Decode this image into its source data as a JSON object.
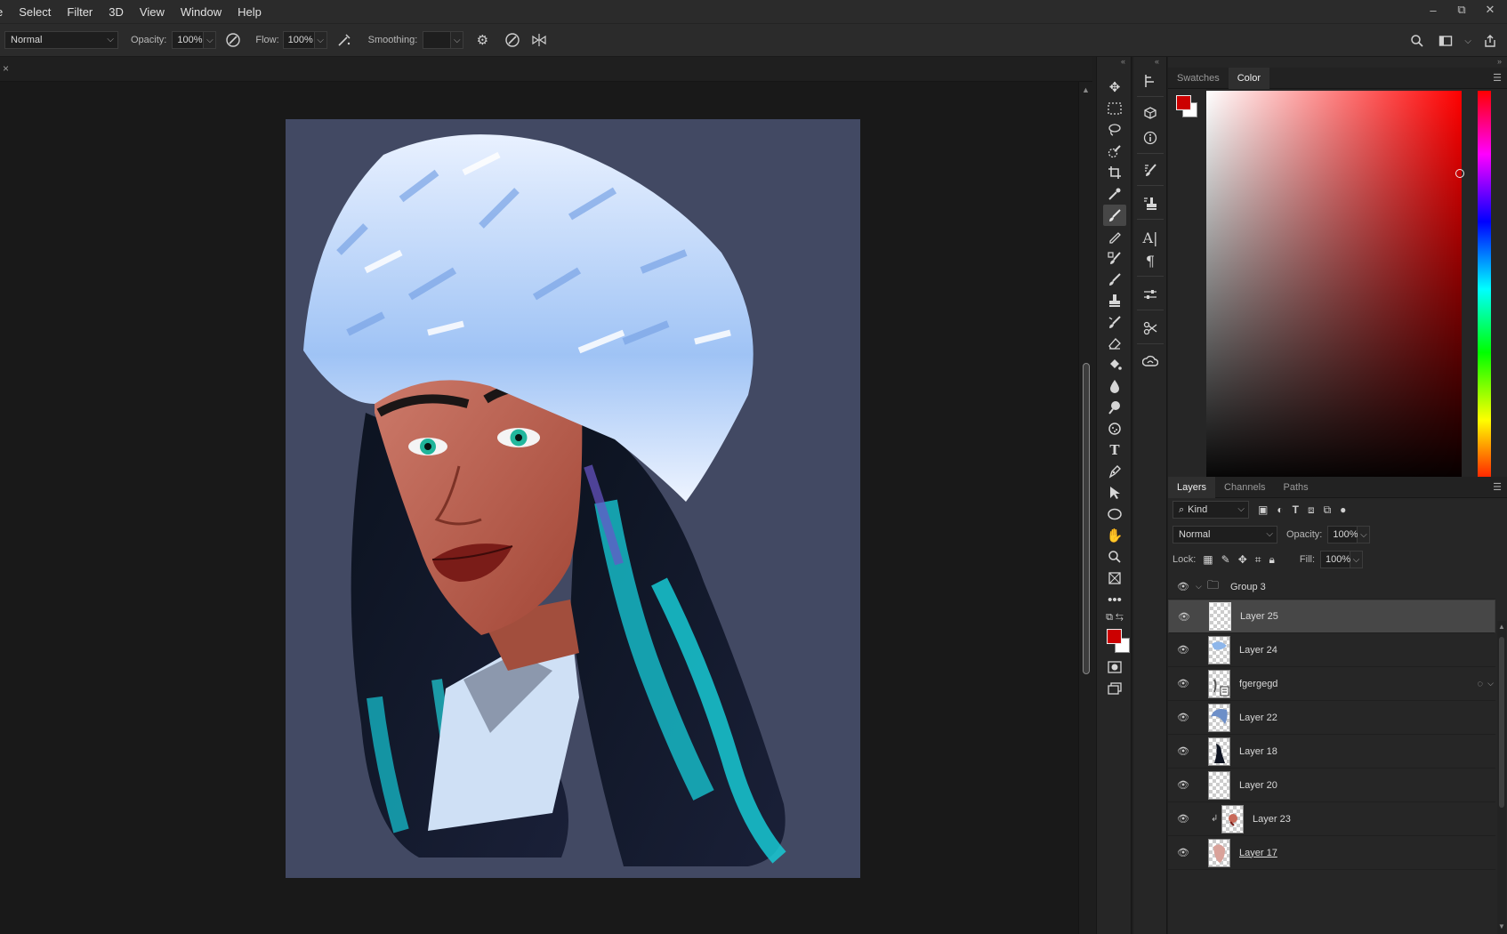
{
  "menu": {
    "items": [
      "e",
      "Select",
      "Filter",
      "3D",
      "View",
      "Window",
      "Help"
    ]
  },
  "window_controls": {
    "minimize": "–",
    "restore": "⧉",
    "close": "✕"
  },
  "options": {
    "blend_mode": "Normal",
    "opacity_label": "Opacity:",
    "opacity_value": "100%",
    "flow_label": "Flow:",
    "flow_value": "100%",
    "smoothing_label": "Smoothing:",
    "smoothing_value": ""
  },
  "doc_tab": {
    "close": "×"
  },
  "panels": {
    "color_tabs": [
      "Swatches",
      "Color"
    ],
    "layers_tabs": [
      "Layers",
      "Channels",
      "Paths"
    ]
  },
  "layers": {
    "filter_kind": "Kind",
    "blend_mode": "Normal",
    "opacity_label": "Opacity:",
    "opacity_value": "100%",
    "lock_label": "Lock:",
    "fill_label": "Fill:",
    "fill_value": "100%",
    "group_name": "Group 3",
    "items": [
      {
        "name": "Layer 25"
      },
      {
        "name": "Layer 24"
      },
      {
        "name": "fgergegd"
      },
      {
        "name": "Layer 22"
      },
      {
        "name": "Layer 18"
      },
      {
        "name": "Layer 20"
      },
      {
        "name": "Layer 23"
      },
      {
        "name": "Layer 17"
      }
    ]
  },
  "colors": {
    "foreground": "#cc0000",
    "background": "#ffffff",
    "canvas_background": "#424963"
  },
  "icons": {
    "tools": [
      "move-icon",
      "marquee-icon",
      "lasso-icon",
      "quick-select-icon",
      "crop-icon",
      "eyedropper-icon",
      "brush-icon",
      "pencil-icon",
      "mixer-brush-icon",
      "history-brush-icon",
      "clone-stamp-icon",
      "art-history-icon",
      "eraser-icon",
      "paint-bucket-icon",
      "blur-icon",
      "dodge-icon",
      "sponge-icon",
      "type-icon",
      "pen-icon",
      "path-select-icon",
      "ellipse-icon",
      "hand-icon",
      "zoom-icon",
      "frame-icon",
      "more-icon"
    ]
  }
}
